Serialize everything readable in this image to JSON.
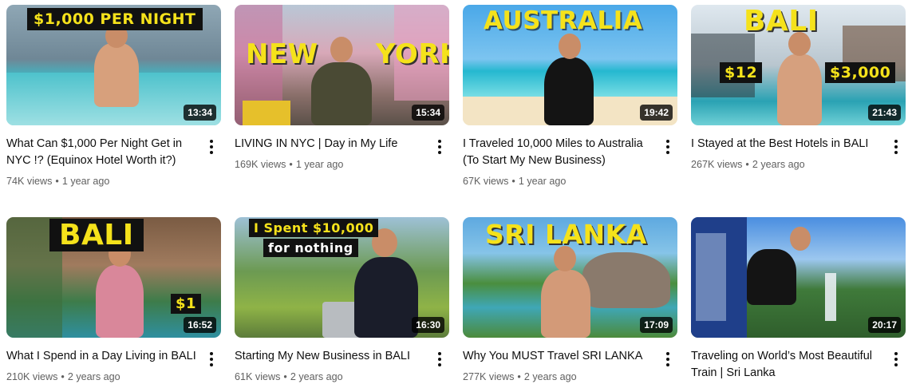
{
  "videos": [
    {
      "title": "What Can $1,000 Per Night Get in NYC !? (Equinox Hotel Worth it?)",
      "views": "74K views",
      "age": "1 year ago",
      "duration": "13:34",
      "thumb_text": [
        "$1,000 PER NIGHT"
      ]
    },
    {
      "title": "LIVING IN NYC | Day in My Life",
      "views": "169K views",
      "age": "1 year ago",
      "duration": "15:34",
      "thumb_text": [
        "NEW YORK"
      ]
    },
    {
      "title": "I Traveled 10,000 Miles to Australia (To Start My New Business)",
      "views": "67K views",
      "age": "1 year ago",
      "duration": "19:42",
      "thumb_text": [
        "AUSTRALIA"
      ]
    },
    {
      "title": "I Stayed at the Best Hotels in BALI",
      "views": "267K views",
      "age": "2 years ago",
      "duration": "21:43",
      "thumb_text": [
        "BALI",
        "$12",
        "$3,000"
      ]
    },
    {
      "title": "What I Spend in a Day Living in BALI",
      "views": "210K views",
      "age": "2 years ago",
      "duration": "16:52",
      "thumb_text": [
        "BALI",
        "$1"
      ]
    },
    {
      "title": "Starting My New Business in BALI",
      "views": "61K views",
      "age": "2 years ago",
      "duration": "16:30",
      "thumb_text": [
        "I Spent $10,000",
        "for nothing"
      ]
    },
    {
      "title": "Why You MUST Travel SRI LANKA",
      "views": "277K views",
      "age": "2 years ago",
      "duration": "17:09",
      "thumb_text": [
        "SRI LANKA"
      ]
    },
    {
      "title": "Traveling on World’s Most Beautiful Train | Sri Lanka",
      "views": "",
      "age": "",
      "duration": "20:17",
      "thumb_text": []
    }
  ],
  "separator": "•",
  "colors": {
    "accent_yellow": "#f5e21b",
    "meta_gray": "#606060",
    "title_black": "#0f0f0f"
  }
}
